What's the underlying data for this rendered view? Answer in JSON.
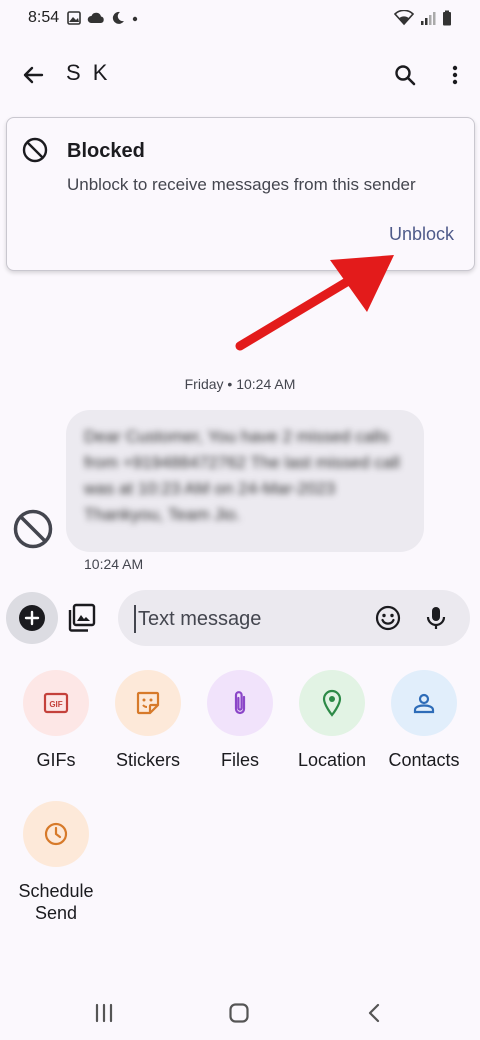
{
  "status_bar": {
    "time": "8:54",
    "left_icons": [
      "gallery-icon",
      "cloud-icon",
      "moon-icon",
      "dot-icon"
    ],
    "right_icons": [
      "wifi-icon",
      "signal-icon",
      "battery-icon"
    ]
  },
  "header": {
    "title": "S K",
    "icons": [
      "back-arrow-icon",
      "search-icon",
      "more-vert-icon"
    ]
  },
  "blocked_banner": {
    "title": "Blocked",
    "description": "Unblock to receive messages from this sender",
    "action_label": "Unblock",
    "icon": "block-icon"
  },
  "conversation": {
    "date_divider": "Friday • 10:24 AM",
    "message": {
      "text": "Dear Customer, You have 2 missed calls from +919488472762 The last missed call was at 10:23 AM on 24-Mar-2023 Thankyou, Team Jio.",
      "time": "10:24 AM"
    }
  },
  "compose": {
    "placeholder": "Text message",
    "icons": [
      "add-icon",
      "gallery-add-icon",
      "emoji-icon",
      "mic-icon"
    ]
  },
  "attachments": [
    {
      "label": "GIFs",
      "icon": "gif-icon",
      "bg": "#fde7e6",
      "color": "#c4413b"
    },
    {
      "label": "Stickers",
      "icon": "sticker-icon",
      "bg": "#fde9d9",
      "color": "#d77a2a"
    },
    {
      "label": "Files",
      "icon": "paperclip-icon",
      "bg": "#f1e3fb",
      "color": "#8b46c8"
    },
    {
      "label": "Location",
      "icon": "location-pin-icon",
      "bg": "#e2f3e4",
      "color": "#2d8a47"
    },
    {
      "label": "Contacts",
      "icon": "person-icon",
      "bg": "#e1eefb",
      "color": "#2e6cb8"
    },
    {
      "label": "Schedule Send",
      "icon": "clock-icon",
      "bg": "#fde9d9",
      "color": "#d77a2a"
    }
  ],
  "nav_bar": {
    "icons": [
      "recents-icon",
      "home-icon",
      "back-icon"
    ]
  },
  "colors": {
    "accent": "#4e5a8a",
    "annotation_arrow": "#e31b1b",
    "background": "#fbf8fd"
  }
}
